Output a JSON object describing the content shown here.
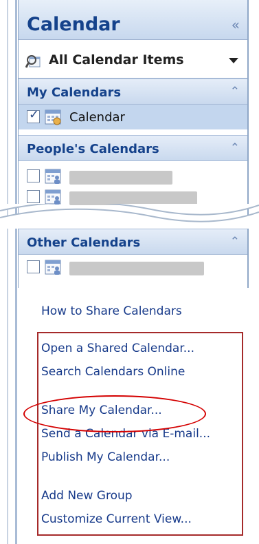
{
  "pane": {
    "title": "Calendar",
    "collapse_glyph": "«",
    "view_selector": {
      "label": "All Calendar Items",
      "icon": "magnifier-calendar-icon"
    }
  },
  "groups": {
    "my_calendars": {
      "title": "My Calendars",
      "toggle_glyph": "⌃",
      "items": [
        {
          "label": "Calendar",
          "checked": true
        }
      ]
    },
    "peoples_calendars": {
      "title": "People's Calendars",
      "toggle_glyph": "⌃"
    },
    "other_calendars": {
      "title": "Other Calendars",
      "toggle_glyph": "⌃"
    }
  },
  "links": {
    "how_to_share": "How to Share Calendars",
    "open_shared": "Open a Shared Calendar...",
    "search_online": "Search Calendars Online",
    "share_my": "Share My Calendar...",
    "send_via_email": "Send a Calendar via E-mail...",
    "publish": "Publish My Calendar...",
    "add_group": "Add New Group",
    "customize_view": "Customize Current View..."
  },
  "colors": {
    "header_text": "#15428b",
    "link_text": "#173a8a",
    "highlight_box": "#a52a2a",
    "highlight_oval": "#d40000",
    "selected_row": "#c3d6ee"
  }
}
